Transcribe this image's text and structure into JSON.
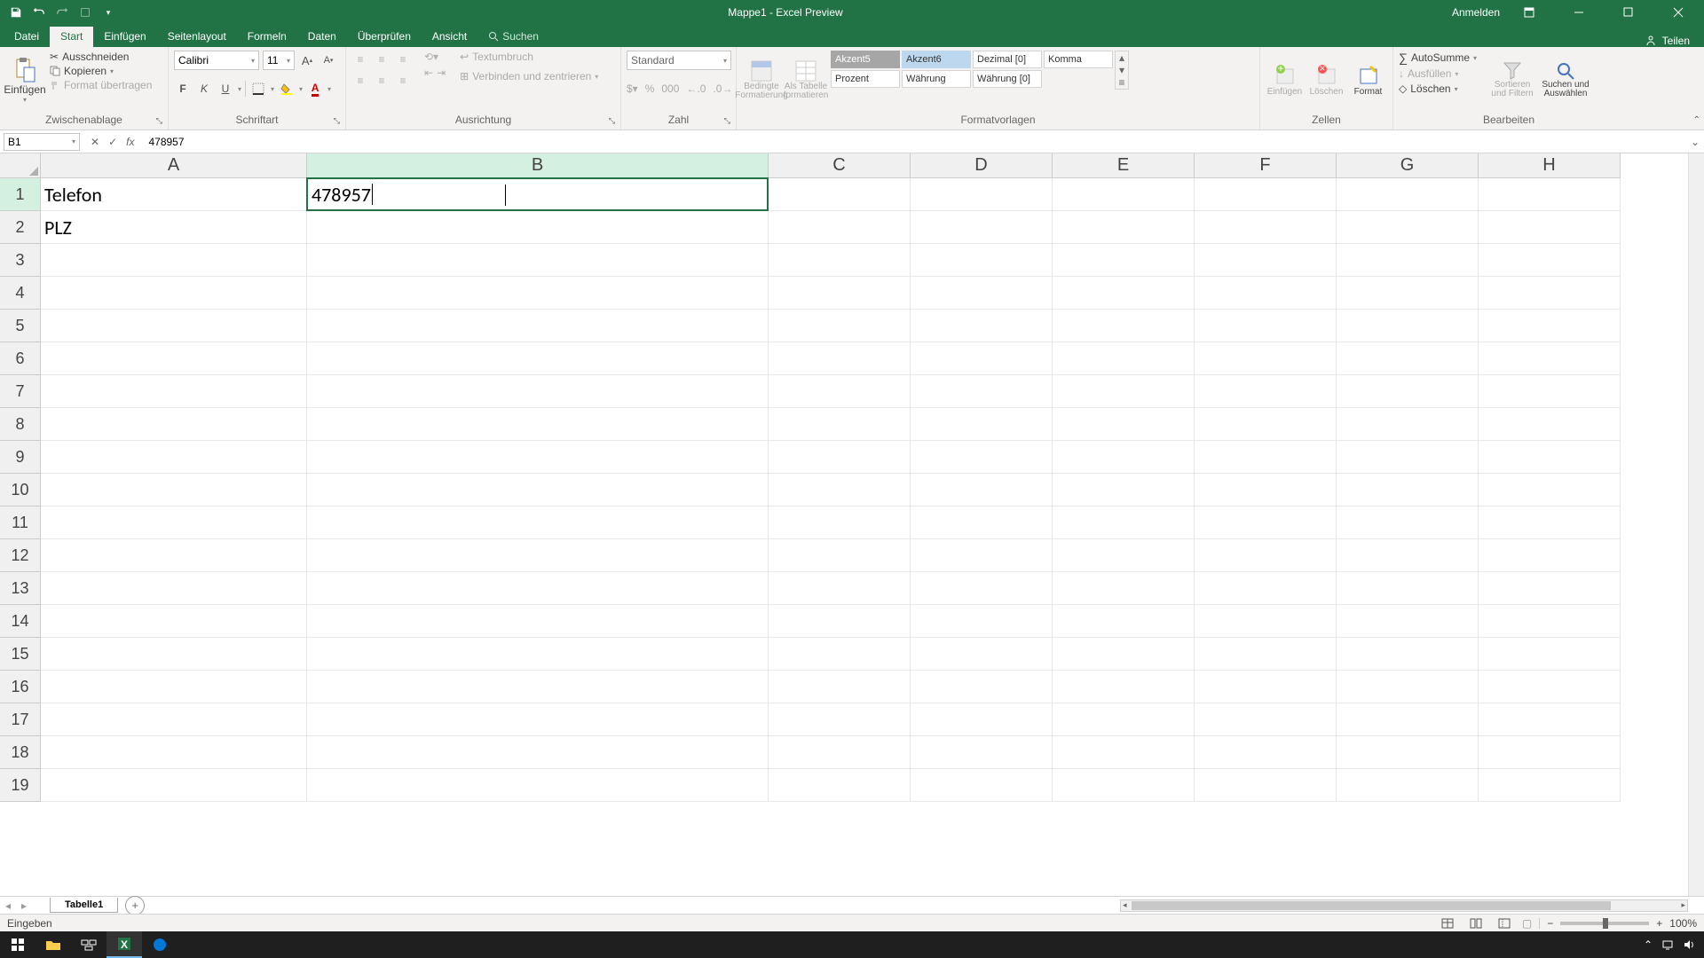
{
  "titlebar": {
    "title": "Mappe1  -  Excel Preview",
    "signin": "Anmelden"
  },
  "tabs": {
    "file": "Datei",
    "home": "Start",
    "insert": "Einfügen",
    "pagelayout": "Seitenlayout",
    "formulas": "Formeln",
    "data": "Daten",
    "review": "Überprüfen",
    "view": "Ansicht",
    "search": "Suchen",
    "share": "Teilen"
  },
  "ribbon": {
    "clipboard": {
      "label": "Zwischenablage",
      "paste": "Einfügen",
      "cut": "Ausschneiden",
      "copy": "Kopieren",
      "formatpainter": "Format übertragen"
    },
    "font": {
      "label": "Schriftart",
      "name": "Calibri",
      "size": "11"
    },
    "alignment": {
      "label": "Ausrichtung",
      "wrap": "Textumbruch",
      "merge": "Verbinden und zentrieren"
    },
    "number": {
      "label": "Zahl",
      "format": "Standard"
    },
    "styles": {
      "label": "Formatvorlagen",
      "cond": "Bedingte Formatierung",
      "table": "Als Tabelle formatieren",
      "g": {
        "akzent5": "Akzent5",
        "akzent6": "Akzent6",
        "dezimal": "Dezimal [0]",
        "komma": "Komma",
        "prozent": "Prozent",
        "wahrung": "Währung",
        "wahrung0": "Währung [0]"
      }
    },
    "cells": {
      "label": "Zellen",
      "insert": "Einfügen",
      "delete": "Löschen",
      "format": "Format"
    },
    "editing": {
      "label": "Bearbeiten",
      "autosum": "AutoSumme",
      "fill": "Ausfüllen",
      "clear": "Löschen",
      "sort": "Sortieren und Filtern",
      "find": "Suchen und Auswählen"
    }
  },
  "formulabar": {
    "namebox": "B1",
    "value": "478957"
  },
  "grid": {
    "cols": [
      "A",
      "B",
      "C",
      "D",
      "E",
      "F",
      "G",
      "H"
    ],
    "cells": {
      "A1": "Telefon",
      "B1": "478957",
      "A2": "PLZ"
    },
    "active_col": "B",
    "active_row": "1"
  },
  "sheettabs": {
    "sheet1": "Tabelle1"
  },
  "statusbar": {
    "mode": "Eingeben",
    "zoom": "100%"
  },
  "colors": {
    "primary": "#217346"
  }
}
